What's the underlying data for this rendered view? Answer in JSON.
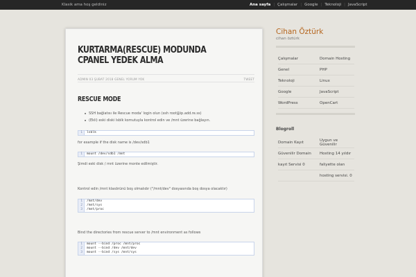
{
  "topbar": {
    "tagline": "Klasik ama hoş geldiniz",
    "nav": [
      "Ana sayfa",
      "Çalışmalar",
      "Google",
      "Teknoloji",
      "JavaScript"
    ]
  },
  "post": {
    "title": "KURTARMA(RESCUE) MODUNDA CPANEL YEDEK ALMA",
    "meta": "ADMIN 03 ŞUBAT 2018 GENEL YORUM YOK",
    "tweet": "TWEET",
    "section": "RESCUE MODE",
    "bullets": [
      "SSH bağlatısı ile Rescue moda' login olun (ssh root@ip.add.re.ss)",
      "(Ekli) eski diski lsblk komutuyla kontrol edin ve /mnt üzerine bağlayın."
    ],
    "code1": [
      {
        "n": "1",
        "t": "lsblk"
      }
    ],
    "p1": "for example if the disk name is /dev/sdb1",
    "code2": [
      {
        "n": "1",
        "t": "mount /dev/sdb1 /mnt"
      }
    ],
    "p2": "Şimdi eski disk / mnt üzerine monte edilmiştir.",
    "p3": "Kontrol edin /mnt klasörünü boş olmalıdır (\"/mnt/dev\" dosyasında boş dosya olacaktır)",
    "code3": [
      {
        "n": "1",
        "t": "/mnt/dev"
      },
      {
        "n": "2",
        "t": "/mnt/sys"
      },
      {
        "n": "3",
        "t": "/mnt/proc"
      }
    ],
    "p4": "Bind the directories from rescue server to /mnt environment as follows",
    "code4": [
      {
        "n": "1",
        "t": "mount --bind /proc /mnt/proc"
      },
      {
        "n": "2",
        "t": "mount --bind /dev /mnt/dev"
      },
      {
        "n": "3",
        "t": "mount --bind /sys /mnt/sys"
      }
    ]
  },
  "sidebar": {
    "title": "Cihan Öztürk",
    "subtitle": "cihan öztürk",
    "categories": [
      [
        "Çalışmalar",
        "Domain Hosting"
      ],
      [
        "Genel",
        "PHP"
      ],
      [
        "Teknoloji",
        "Linux"
      ],
      [
        "Google",
        "JavaScript"
      ],
      [
        "WordPress",
        "OpenCart"
      ]
    ],
    "blogroll_title": "Blogroll",
    "blogroll": [
      [
        "Domain Kayıt",
        "Uygun ve Güvenilir"
      ],
      [
        "Güvenilir Domain",
        "Hosting 14 yıldır"
      ],
      [
        "kayıt Servisi 0",
        "faliyette olan"
      ],
      [
        "",
        "hosting servisi. 0"
      ]
    ]
  },
  "colors": {
    "accent": "#b5651d",
    "topbar": "#262626",
    "background": "#e6e4de"
  }
}
